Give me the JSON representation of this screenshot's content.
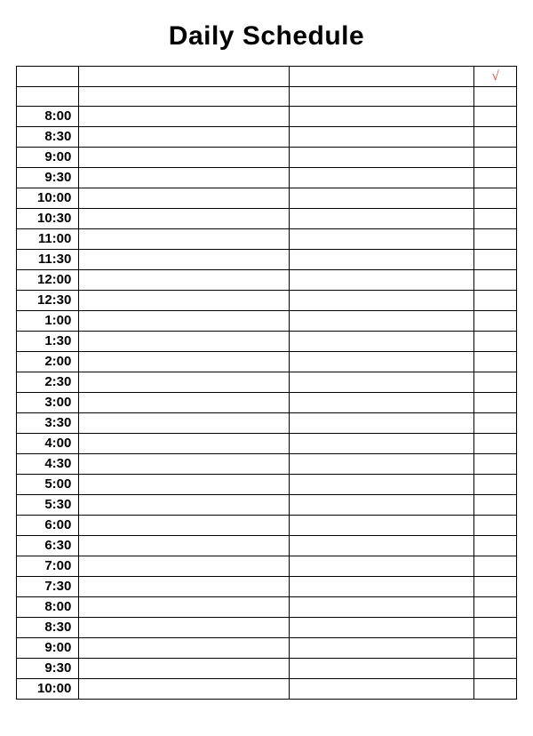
{
  "title": "Daily Schedule",
  "check_header": "√",
  "times": [
    "8:00",
    "8:30",
    "9:00",
    "9:30",
    "10:00",
    "10:30",
    "11:00",
    "11:30",
    "12:00",
    "12:30",
    "1:00",
    "1:30",
    "2:00",
    "2:30",
    "3:00",
    "3:30",
    "4:00",
    "4:30",
    "5:00",
    "5:30",
    "6:00",
    "6:30",
    "7:00",
    "7:30",
    "8:00",
    "8:30",
    "9:00",
    "9:30",
    "10:00"
  ]
}
